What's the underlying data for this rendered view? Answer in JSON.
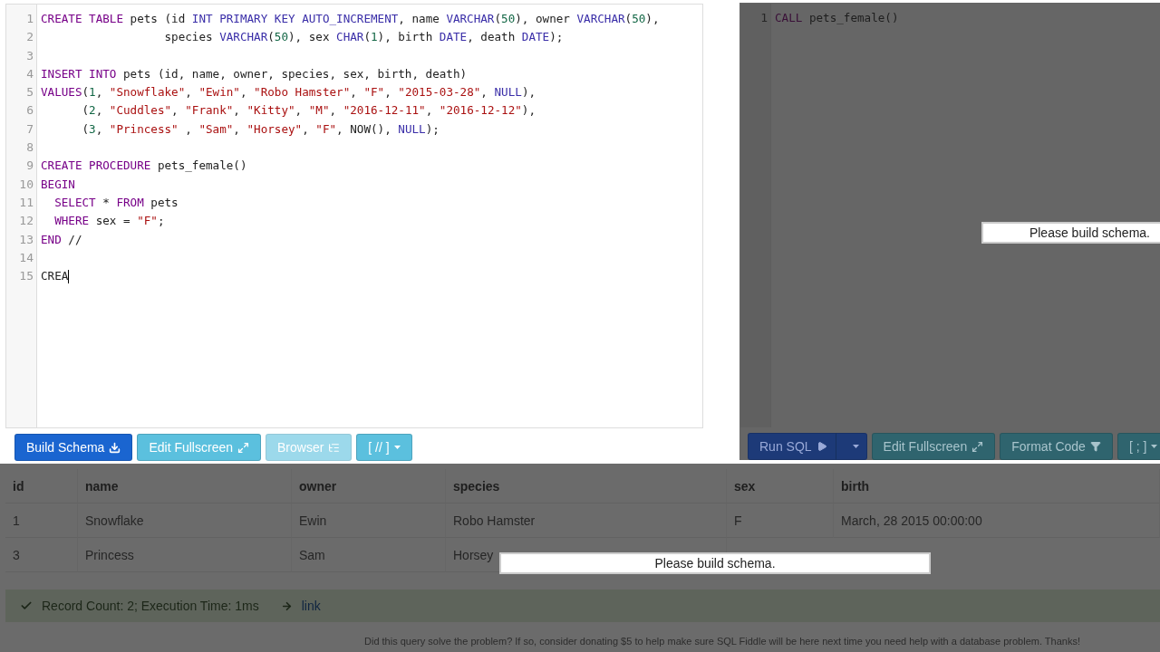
{
  "schema_editor": {
    "lines": [
      {
        "number": "1",
        "tokens": [
          {
            "text": "CREATE TABLE",
            "kind": "keyword"
          },
          {
            "text": " pets (id ",
            "kind": "plain"
          },
          {
            "text": "INT PRIMARY KEY AUTO_INCREMENT",
            "kind": "builtin"
          },
          {
            "text": ", name ",
            "kind": "plain"
          },
          {
            "text": "VARCHAR",
            "kind": "builtin"
          },
          {
            "text": "(",
            "kind": "plain"
          },
          {
            "text": "50",
            "kind": "number"
          },
          {
            "text": "), owner ",
            "kind": "plain"
          },
          {
            "text": "VARCHAR",
            "kind": "builtin"
          },
          {
            "text": "(",
            "kind": "plain"
          },
          {
            "text": "50",
            "kind": "number"
          },
          {
            "text": "),",
            "kind": "plain"
          }
        ]
      },
      {
        "number": "2",
        "tokens": [
          {
            "text": "                  species ",
            "kind": "plain"
          },
          {
            "text": "VARCHAR",
            "kind": "builtin"
          },
          {
            "text": "(",
            "kind": "plain"
          },
          {
            "text": "50",
            "kind": "number"
          },
          {
            "text": "), sex ",
            "kind": "plain"
          },
          {
            "text": "CHAR",
            "kind": "builtin"
          },
          {
            "text": "(",
            "kind": "plain"
          },
          {
            "text": "1",
            "kind": "number"
          },
          {
            "text": "), birth ",
            "kind": "plain"
          },
          {
            "text": "DATE",
            "kind": "builtin"
          },
          {
            "text": ", death ",
            "kind": "plain"
          },
          {
            "text": "DATE",
            "kind": "builtin"
          },
          {
            "text": ");",
            "kind": "plain"
          }
        ]
      },
      {
        "number": "3"
      },
      {
        "number": "4",
        "tokens": [
          {
            "text": "INSERT INTO",
            "kind": "keyword"
          },
          {
            "text": " pets (id, name, owner, species, sex, birth, death)",
            "kind": "plain"
          }
        ]
      },
      {
        "number": "5",
        "tokens": [
          {
            "text": "VALUES",
            "kind": "keyword"
          },
          {
            "text": "(",
            "kind": "plain"
          },
          {
            "text": "1",
            "kind": "number"
          },
          {
            "text": ", ",
            "kind": "plain"
          },
          {
            "text": "\"Snowflake\"",
            "kind": "string"
          },
          {
            "text": ", ",
            "kind": "plain"
          },
          {
            "text": "\"Ewin\"",
            "kind": "string"
          },
          {
            "text": ", ",
            "kind": "plain"
          },
          {
            "text": "\"Robo Hamster\"",
            "kind": "string"
          },
          {
            "text": ", ",
            "kind": "plain"
          },
          {
            "text": "\"F\"",
            "kind": "string"
          },
          {
            "text": ", ",
            "kind": "plain"
          },
          {
            "text": "\"2015-03-28\"",
            "kind": "string"
          },
          {
            "text": ", ",
            "kind": "plain"
          },
          {
            "text": "NULL",
            "kind": "builtin"
          },
          {
            "text": "),",
            "kind": "plain"
          }
        ]
      },
      {
        "number": "6",
        "tokens": [
          {
            "text": "      (",
            "kind": "plain"
          },
          {
            "text": "2",
            "kind": "number"
          },
          {
            "text": ", ",
            "kind": "plain"
          },
          {
            "text": "\"Cuddles\"",
            "kind": "string"
          },
          {
            "text": ", ",
            "kind": "plain"
          },
          {
            "text": "\"Frank\"",
            "kind": "string"
          },
          {
            "text": ", ",
            "kind": "plain"
          },
          {
            "text": "\"Kitty\"",
            "kind": "string"
          },
          {
            "text": ", ",
            "kind": "plain"
          },
          {
            "text": "\"M\"",
            "kind": "string"
          },
          {
            "text": ", ",
            "kind": "plain"
          },
          {
            "text": "\"2016-12-11\"",
            "kind": "string"
          },
          {
            "text": ", ",
            "kind": "plain"
          },
          {
            "text": "\"2016-12-12\"",
            "kind": "string"
          },
          {
            "text": "),",
            "kind": "plain"
          }
        ]
      },
      {
        "number": "7",
        "tokens": [
          {
            "text": "      (",
            "kind": "plain"
          },
          {
            "text": "3",
            "kind": "number"
          },
          {
            "text": ", ",
            "kind": "plain"
          },
          {
            "text": "\"Princess\"",
            "kind": "string"
          },
          {
            "text": " , ",
            "kind": "plain"
          },
          {
            "text": "\"Sam\"",
            "kind": "string"
          },
          {
            "text": ", ",
            "kind": "plain"
          },
          {
            "text": "\"Horsey\"",
            "kind": "string"
          },
          {
            "text": ", ",
            "kind": "plain"
          },
          {
            "text": "\"F\"",
            "kind": "string"
          },
          {
            "text": ", NOW(), ",
            "kind": "plain"
          },
          {
            "text": "NULL",
            "kind": "builtin"
          },
          {
            "text": ");",
            "kind": "plain"
          }
        ]
      },
      {
        "number": "8"
      },
      {
        "number": "9",
        "tokens": [
          {
            "text": "CREATE PROCEDURE",
            "kind": "keyword"
          },
          {
            "text": " pets_female()",
            "kind": "plain"
          }
        ]
      },
      {
        "number": "10",
        "tokens": [
          {
            "text": "BEGIN",
            "kind": "keyword"
          }
        ]
      },
      {
        "number": "11",
        "tokens": [
          {
            "text": "  SELECT",
            "kind": "keyword"
          },
          {
            "text": " * ",
            "kind": "plain"
          },
          {
            "text": "FROM",
            "kind": "keyword"
          },
          {
            "text": " pets",
            "kind": "plain"
          }
        ]
      },
      {
        "number": "12",
        "tokens": [
          {
            "text": "  WHERE",
            "kind": "keyword"
          },
          {
            "text": " sex = ",
            "kind": "plain"
          },
          {
            "text": "\"F\"",
            "kind": "string"
          },
          {
            "text": ";",
            "kind": "plain"
          }
        ]
      },
      {
        "number": "13",
        "tokens": [
          {
            "text": "END",
            "kind": "keyword"
          },
          {
            "text": " //",
            "kind": "plain"
          }
        ]
      },
      {
        "number": "14"
      },
      {
        "number": "15",
        "tokens": [
          {
            "text": "CREA",
            "kind": "plain"
          }
        ]
      }
    ]
  },
  "schema_buttons": [
    {
      "label": "Build Schema",
      "kind": "primary",
      "disabled": false
    },
    {
      "label": "Edit Fullscreen",
      "kind": "info",
      "disabled": false
    },
    {
      "label": "Browser",
      "kind": "info",
      "disabled": true
    },
    {
      "label": "[ // ]",
      "kind": "dropdown",
      "disabled": false
    }
  ],
  "query_editor": {
    "lines": [
      {
        "number": "1",
        "tokens": [
          {
            "text": "CALL",
            "kind": "keyword"
          },
          {
            "text": " pets_female()",
            "kind": "plain"
          }
        ]
      }
    ],
    "message": "Please build schema."
  },
  "query_buttons": [
    {
      "label": "Run SQL",
      "kind": "split"
    },
    {
      "label": "Edit Fullscreen",
      "kind": "info"
    },
    {
      "label": "Format Code",
      "kind": "info"
    },
    {
      "label": "[ ; ]",
      "kind": "dropdown"
    }
  ],
  "results": {
    "columns": [
      "id",
      "name",
      "owner",
      "species",
      "sex",
      "birth"
    ],
    "rows": [
      [
        "1",
        "Snowflake",
        "Ewin",
        "Robo Hamster",
        "F",
        "March, 28 2015 00:00:00"
      ],
      [
        "3",
        "Princess",
        "Sam",
        "Horsey",
        null,
        null
      ]
    ],
    "message": "Please build schema.",
    "status": "Record Count: 2; Execution Time: 1ms",
    "link": "link",
    "footer": "Did this query solve the problem? If so, consider donating $5 to help make sure SQL Fiddle will be here next time you need help with a database problem. Thanks!"
  }
}
